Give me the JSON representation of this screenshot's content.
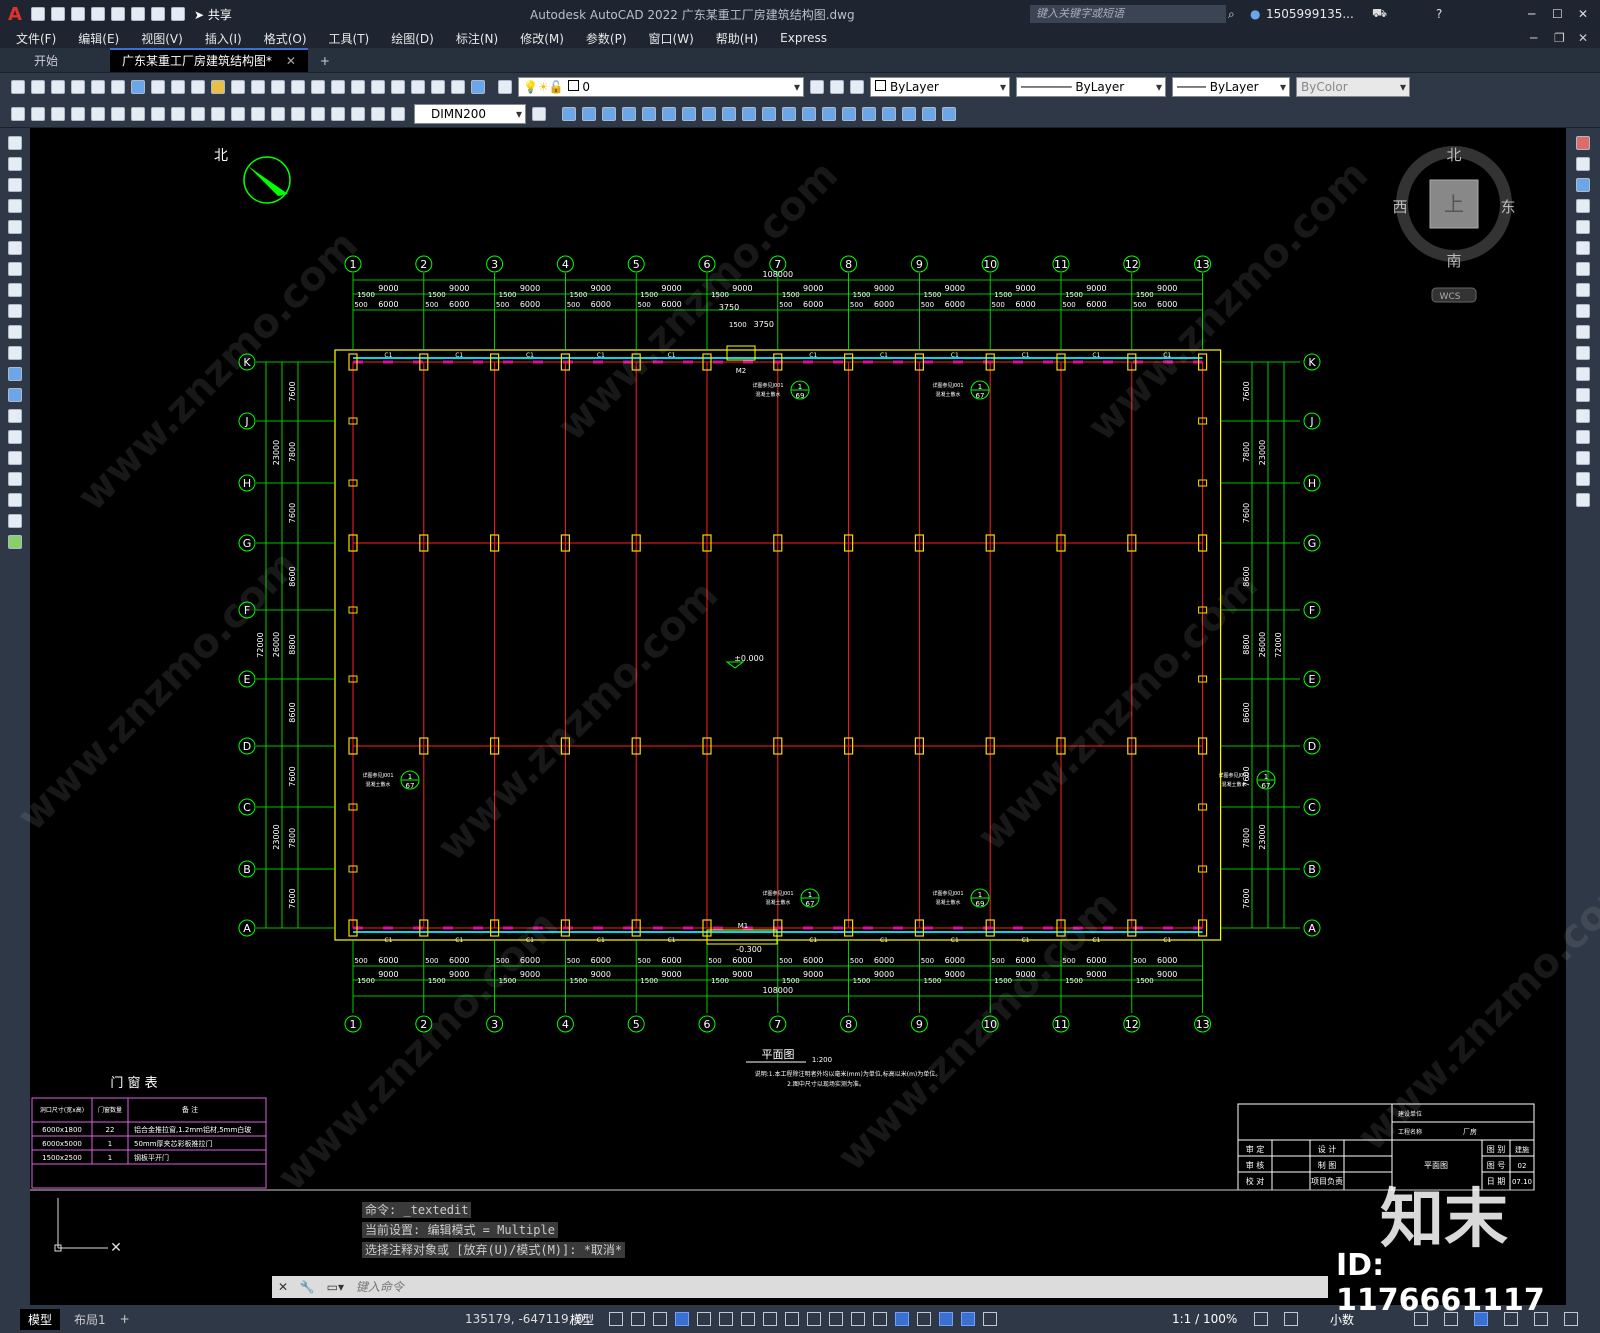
{
  "titlebar": {
    "app_logo": "A",
    "share": "共享",
    "title": "Autodesk AutoCAD 2022    广东某重工厂房建筑结构图.dwg",
    "search_placeholder": "键入关键字或短语",
    "user": "1505999135..."
  },
  "menu": [
    "文件(F)",
    "编辑(E)",
    "视图(V)",
    "插入(I)",
    "格式(O)",
    "工具(T)",
    "绘图(D)",
    "标注(N)",
    "修改(M)",
    "参数(P)",
    "窗口(W)",
    "帮助(H)",
    "Express"
  ],
  "tabs": {
    "start": "开始",
    "active": "广东某重工厂房建筑结构图*",
    "close": "✕",
    "add": "+"
  },
  "toolbar": {
    "layer_value": "0",
    "color": "ByLayer",
    "linetype": "ByLayer",
    "lineweight": "ByLayer",
    "plotstyle": "ByColor",
    "dimstyle": "DIMN200"
  },
  "compass": {
    "north": "北",
    "south": "南",
    "east": "东",
    "west": "西",
    "center": "上",
    "wcs": "WCS"
  },
  "north_arrow": "北",
  "drawing": {
    "axes_num": [
      "1",
      "2",
      "3",
      "4",
      "5",
      "6",
      "7",
      "8",
      "9",
      "10",
      "11",
      "12",
      "13"
    ],
    "axes_letter": [
      "K",
      "J",
      "H",
      "G",
      "F",
      "E",
      "D",
      "C",
      "B",
      "A"
    ],
    "total_top": "108000",
    "total_bottom": "108000",
    "span": "9000",
    "sub_a": "6000",
    "sub_b": "1500",
    "sub_c": "500",
    "sub_d": "3750",
    "left_dims": [
      "7600",
      "7800",
      "7600",
      "8600",
      "8800",
      "8600",
      "7600",
      "7800",
      "7600"
    ],
    "left_sub": [
      "23000",
      "26000",
      "23000"
    ],
    "overall_side": "72000",
    "door_top": "M2",
    "door_bottom": "M1",
    "window": "C1",
    "level_center": "±0.000",
    "level_bottom": "-0.300",
    "callout_ref": "详图参见J001",
    "callout_sub": "混凝土散水",
    "callout_nums": [
      "67",
      "69"
    ],
    "plan_title": "平面图",
    "plan_scale": "1:200",
    "note1": "说明:1.本工程除注明者外均以毫米(mm)为单位,标高以米(m)为单位。",
    "note2": "2.图中尺寸以现场实测为准。"
  },
  "door_table": {
    "title": "门  窗  表",
    "headers": [
      "洞口尺寸(宽x高)",
      "门窗数量",
      "备      注"
    ],
    "rows": [
      [
        "6000x1800",
        "22",
        "铝合金推拉窗,1.2mm铝材,5mm白玻"
      ],
      [
        "6000x5000",
        "1",
        "50mm厚夹芯彩板推拉门"
      ],
      [
        "1500x2500",
        "1",
        "钢板平开门"
      ]
    ]
  },
  "title_block": {
    "unit_label": "建设单位",
    "project_label": "工程名称",
    "project_value": "厂房",
    "rows": [
      [
        "审 定",
        "设 计"
      ],
      [
        "审 核",
        "制 图"
      ],
      [
        "校 对",
        "项目负责"
      ]
    ],
    "drawing_name": "平面图",
    "right": [
      [
        "图 别",
        "建施"
      ],
      [
        "图 号",
        "02"
      ],
      [
        "日 期",
        "07.10"
      ]
    ]
  },
  "command": {
    "line1": "命令: _textedit",
    "line2": "当前设置: 编辑模式 = Multiple",
    "line3": "选择注释对象或 [放弃(U)/模式(M)]: *取消*",
    "placeholder": "键入命令"
  },
  "status": {
    "model_tab": "模型",
    "layout_tab": "布局1",
    "add": "+",
    "coords": "135179, -647119, 0",
    "mode": "模型",
    "scale": "1:1 / 100%",
    "units": "小数"
  },
  "watermark": {
    "text": "www.znzmo.com",
    "brand": "知末",
    "id": "ID: 1176661117"
  },
  "colors": {
    "grid": "#00ff00",
    "beam": "#ff2020",
    "wall": "#ffff00",
    "column": "#ffd700",
    "cyan": "#00d8e8",
    "magenta": "#d000d0"
  }
}
